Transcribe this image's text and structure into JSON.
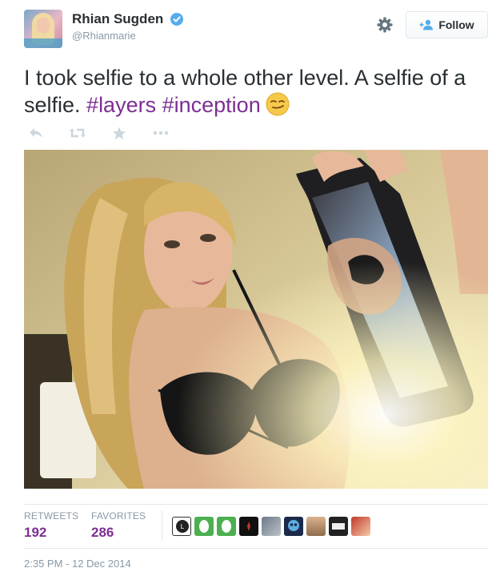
{
  "user": {
    "display_name": "Rhian Sugden",
    "handle": "@Rhianmarie",
    "verified": true,
    "avatar_icon": "profile-photo"
  },
  "header": {
    "follow_label": "Follow",
    "gear_icon": "gear-icon"
  },
  "tweet": {
    "text_plain": "I took selfie to a whole other level. A selfie of a selfie. ",
    "hashtags": [
      "#layers",
      "#inception"
    ],
    "emoji": "smirking-face-emoji"
  },
  "actions": [
    "reply-icon",
    "retweet-icon",
    "favorite-icon",
    "more-icon"
  ],
  "stats": {
    "retweets_label": "RETWEETS",
    "retweets_value": "192",
    "favorites_label": "FAVORITES",
    "favorites_value": "286"
  },
  "favoriters_count": 9,
  "timestamp": "2:35 PM - 12 Dec 2014",
  "colors": {
    "hashtag": "#7d2f93",
    "verified": "#55acee",
    "muted": "#8899a6"
  }
}
